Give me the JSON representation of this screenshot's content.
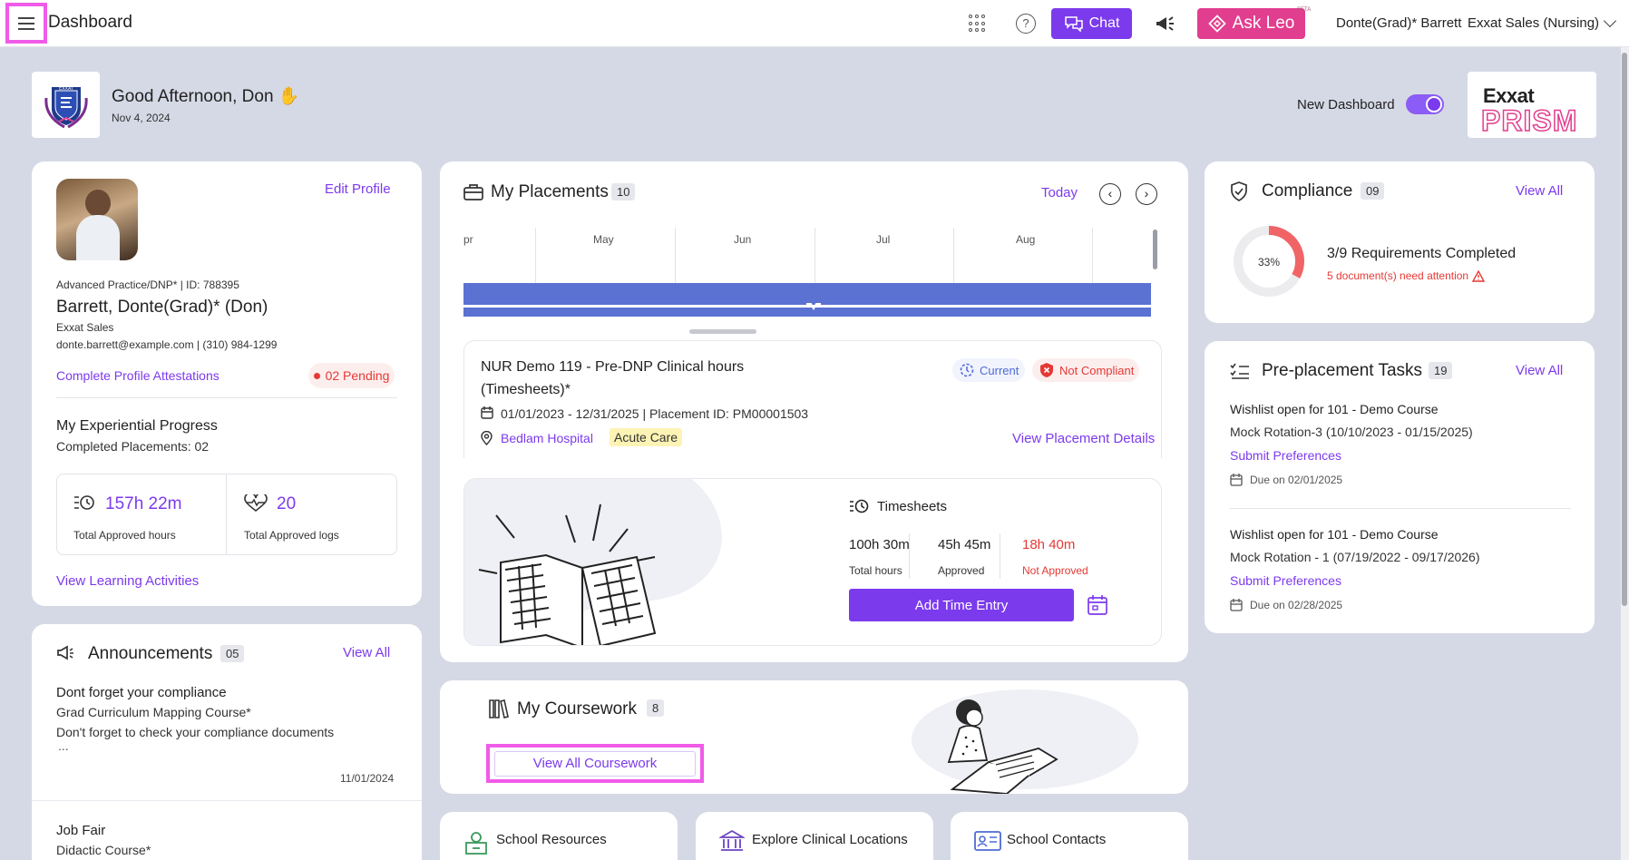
{
  "topbar": {
    "title": "Dashboard",
    "chat_label": "Chat",
    "ask_leo_label": "Ask Leo",
    "beta_label": "BETA",
    "user_name": "Donte(Grad)* Barrett",
    "org_name": "Exxat Sales (Nursing)"
  },
  "header": {
    "greeting": "Good Afternoon, Don",
    "date": "Nov 4, 2024",
    "new_dashboard_label": "New Dashboard",
    "brand_top": "Exxat",
    "brand_bottom": "PRISM",
    "logo_text": "EXXAT"
  },
  "profile": {
    "edit_label": "Edit Profile",
    "program_id": "Advanced Practice/DNP* | ID: 788395",
    "name": "Barrett, Donte(Grad)* (Don)",
    "org": "Exxat Sales",
    "contact": "donte.barrett@example.com | (310) 984-1299",
    "attestations_label": "Complete Profile Attestations",
    "pending_label": "02 Pending",
    "progress_title": "My Experiential Progress",
    "completed_placements": "Completed Placements: 02",
    "hours_value": "157h 22m",
    "hours_label": "Total Approved hours",
    "logs_value": "20",
    "logs_label": "Total Approved logs",
    "learning_link": "View Learning Activities"
  },
  "announcements": {
    "title": "Announcements",
    "count": "05",
    "view_all": "View All",
    "items": [
      {
        "title": "Dont forget your compliance",
        "course": "Grad Curriculum Mapping Course*",
        "body": "Don't forget to check your compliance documents",
        "more": "...",
        "date": "11/01/2024"
      },
      {
        "title": "Job Fair",
        "course": "Didactic Course*"
      }
    ]
  },
  "placements": {
    "title": "My Placements",
    "count": "10",
    "today_label": "Today",
    "months": [
      "pr",
      "May",
      "Jun",
      "Jul",
      "Aug"
    ],
    "course_title_line1": "NUR Demo 119 - Pre-DNP Clinical hours",
    "course_title_line2": "(Timesheets)*",
    "current_label": "Current",
    "not_compliant_label": "Not Compliant",
    "dates": "01/01/2023 - 12/31/2025 | Placement ID: PM00001503",
    "site": "Bedlam Hospital",
    "setting": "Acute Care",
    "details_link": "View Placement Details",
    "timesheets_title": "Timesheets",
    "total_hours_value": "100h 30m",
    "total_hours_label": "Total hours",
    "approved_value": "45h 45m",
    "approved_label": "Approved",
    "not_approved_value": "18h 40m",
    "not_approved_label": "Not Approved",
    "add_time_label": "Add Time Entry"
  },
  "coursework": {
    "title": "My Coursework",
    "count": "8",
    "view_all_label": "View All Coursework"
  },
  "quick_links": [
    {
      "label": "School Resources"
    },
    {
      "label": "Explore Clinical Locations"
    },
    {
      "label": "School Contacts"
    }
  ],
  "compliance": {
    "title": "Compliance",
    "count": "09",
    "view_all": "View All",
    "percent_label": "33%",
    "percent": 0.33,
    "requirements": "3/9 Requirements Completed",
    "attention": "5 document(s) need attention"
  },
  "tasks": {
    "title": "Pre-placement Tasks",
    "count": "19",
    "view_all": "View All",
    "items": [
      {
        "title": "Wishlist open for 101 - Demo Course",
        "rotation": "Mock Rotation-3 (10/10/2023 - 01/15/2025)",
        "action": "Submit Preferences",
        "due": "Due on 02/01/2025"
      },
      {
        "title": "Wishlist open for 101 - Demo Course",
        "rotation": "Mock Rotation - 1 (07/19/2022 - 09/17/2026)",
        "action": "Submit Preferences",
        "due": "Due on 02/28/2025"
      }
    ]
  },
  "colors": {
    "accent": "#7c3aed",
    "pink": "#e23e8f",
    "timeline": "#5b72d2",
    "error": "#e53935"
  }
}
